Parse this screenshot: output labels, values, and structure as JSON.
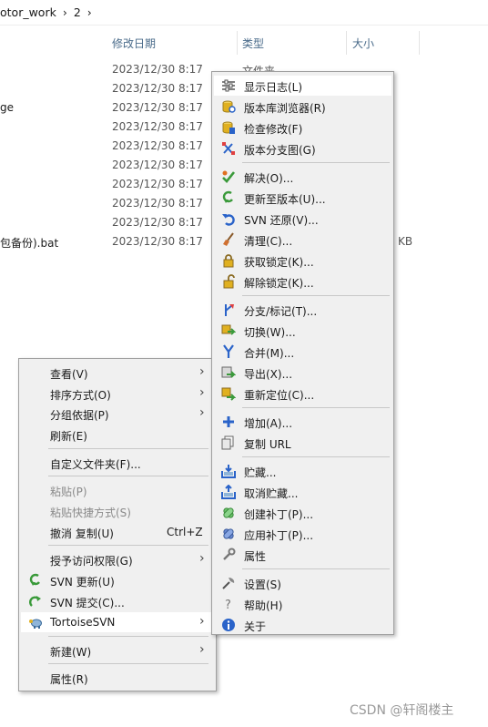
{
  "breadcrumb": {
    "folder": "otor_work",
    "sub": "2",
    "sep1": "›",
    "sep2": "›"
  },
  "columns": {
    "date": "修改日期",
    "type": "类型",
    "size": "大小"
  },
  "files": [
    {
      "name": "",
      "date": "2023/12/30 8:17",
      "type": "文件夹",
      "size": ""
    },
    {
      "name": "",
      "date": "2023/12/30 8:17",
      "type": "",
      "size": ""
    },
    {
      "name": "ge",
      "date": "2023/12/30 8:17",
      "type": "",
      "size": ""
    },
    {
      "name": "",
      "date": "2023/12/30 8:17",
      "type": "",
      "size": ""
    },
    {
      "name": "",
      "date": "2023/12/30 8:17",
      "type": "",
      "size": ""
    },
    {
      "name": "",
      "date": "2023/12/30 8:17",
      "type": "",
      "size": ""
    },
    {
      "name": "",
      "date": "2023/12/30 8:17",
      "type": "",
      "size": ""
    },
    {
      "name": "",
      "date": "2023/12/30 8:17",
      "type": "",
      "size": ""
    },
    {
      "name": "",
      "date": "2023/12/30 8:17",
      "type": "",
      "size": ""
    },
    {
      "name": "包备份).bat",
      "date": "2023/12/30 8:17",
      "type": "",
      "size": "KB"
    }
  ],
  "context_menu": {
    "view": "查看(V)",
    "sort": "排序方式(O)",
    "group": "分组依据(P)",
    "refresh": "刷新(E)",
    "customize": "自定义文件夹(F)...",
    "paste": "粘贴(P)",
    "paste_shortcut": "粘贴快捷方式(S)",
    "undo_copy": "撤消 复制(U)",
    "undo_accel": "Ctrl+Z",
    "grant_access": "授予访问权限(G)",
    "svn_update": "SVN 更新(U)",
    "svn_commit": "SVN 提交(C)...",
    "tortoise": "TortoiseSVN",
    "new": "新建(W)",
    "properties": "属性(R)",
    "arrow": "›"
  },
  "svn_menu": {
    "show_log": "显示日志(L)",
    "repo_browser": "版本库浏览器(R)",
    "check_mods": "检查修改(F)",
    "revision_graph": "版本分支图(G)",
    "resolve": "解决(O)...",
    "update_to_rev": "更新至版本(U)...",
    "revert": "SVN 还原(V)...",
    "cleanup": "清理(C)...",
    "get_lock": "获取锁定(K)...",
    "release_lock": "解除锁定(K)...",
    "branch_tag": "分支/标记(T)...",
    "switch": "切换(W)...",
    "merge": "合并(M)...",
    "export": "导出(X)...",
    "relocate": "重新定位(C)...",
    "add": "增加(A)...",
    "copy_url": "复制 URL",
    "shelve": "贮藏...",
    "unshelve": "取消贮藏...",
    "create_patch": "创建补丁(P)...",
    "apply_patch": "应用补丁(P)...",
    "properties": "属性",
    "settings": "设置(S)",
    "help": "帮助(H)",
    "about": "关于"
  },
  "watermark": "CSDN @轩阁楼主",
  "colors": {
    "menu_bg": "#f0f0f0",
    "highlight": "#ffffff",
    "svn_green": "#3a9a3a",
    "svn_blue": "#2a63c9",
    "svn_yellow": "#e0b020"
  }
}
